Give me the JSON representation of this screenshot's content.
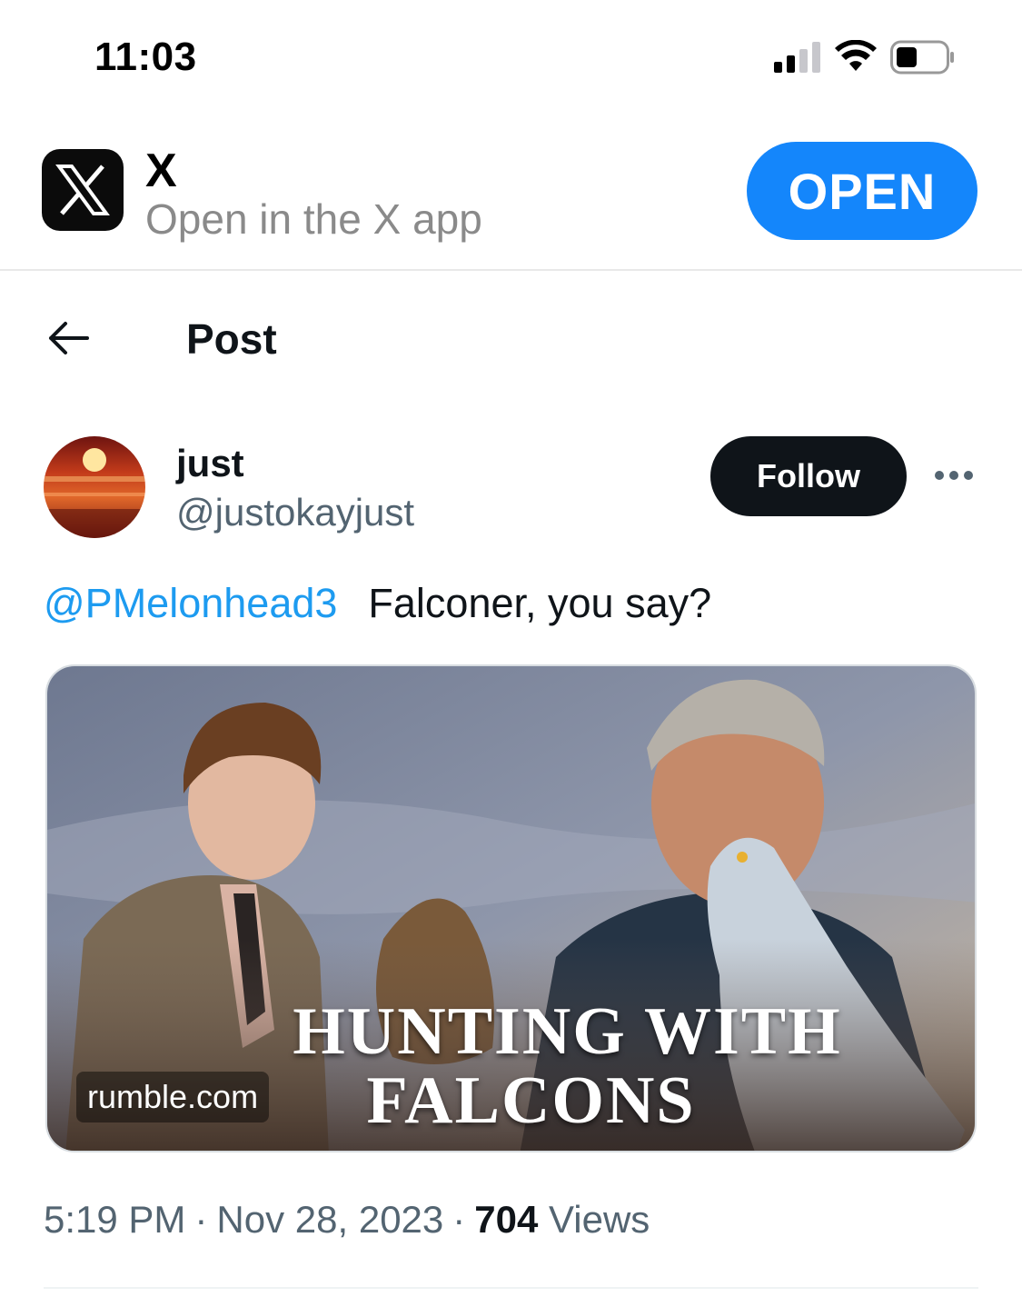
{
  "status_bar": {
    "time": "11:03",
    "icons": [
      "cellular-signal-icon",
      "wifi-icon",
      "battery-icon"
    ]
  },
  "app_banner": {
    "app_name": "X",
    "subtitle": "Open in the X app",
    "open_label": "OPEN",
    "icon": "x-logo-icon",
    "accent_color": "#1486fb"
  },
  "header": {
    "title": "Post",
    "back_icon": "back-arrow-icon"
  },
  "post": {
    "author": {
      "display_name": "just",
      "handle": "@justokayjust"
    },
    "follow_label": "Follow",
    "more_icon": "more-options-icon",
    "mention": "@PMelonhead3",
    "text": "Falconer, you say?",
    "media": {
      "title_line1": "HUNTING WITH",
      "title_line2": "FALCONS",
      "domain": "rumble.com"
    },
    "time": "5:19 PM",
    "date": "Nov 28, 2023",
    "views_count": "704",
    "views_label": "Views",
    "separator": "·"
  },
  "colors": {
    "link": "#1d9bf0",
    "secondary_text": "#536471",
    "primary_text": "#0f1419"
  }
}
